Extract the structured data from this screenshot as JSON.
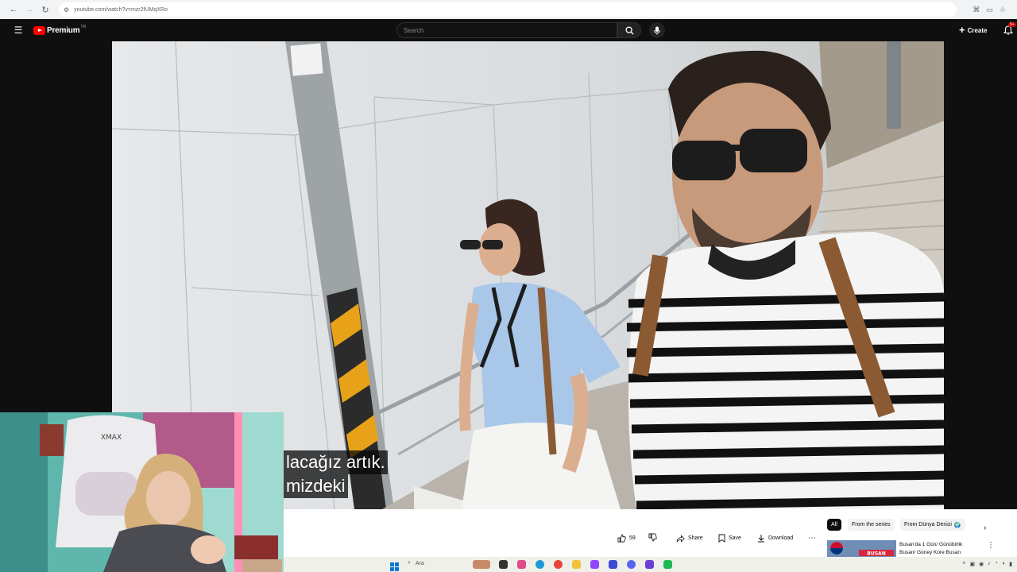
{
  "browser": {
    "url": "youtube.com/watch?v=mzr2fUMqXRo"
  },
  "header": {
    "brand": "Premium",
    "region": "TR",
    "search_placeholder": "Search",
    "create_label": "Create",
    "notification_count": "9+"
  },
  "video": {
    "captions": [
      "lacağız artık.",
      "mizdeki"
    ]
  },
  "actions": {
    "like_count": "59",
    "share_label": "Share",
    "save_label": "Save",
    "download_label": "Download"
  },
  "chips": {
    "all": "All",
    "series": "From the series",
    "channel": "From Dünya Denizi",
    "channel_emoji": "🌍"
  },
  "recommendation": {
    "title": "Busan'da 1 Gün/ Günübirlik Busan/ Güney Kore Busan",
    "thumb_label": "BUSAN"
  },
  "taskbar": {
    "search_label": "Ara"
  },
  "colors": {
    "accent": "#ff0000",
    "header_bg": "#0f0f0f",
    "badge": "#cc0000"
  }
}
